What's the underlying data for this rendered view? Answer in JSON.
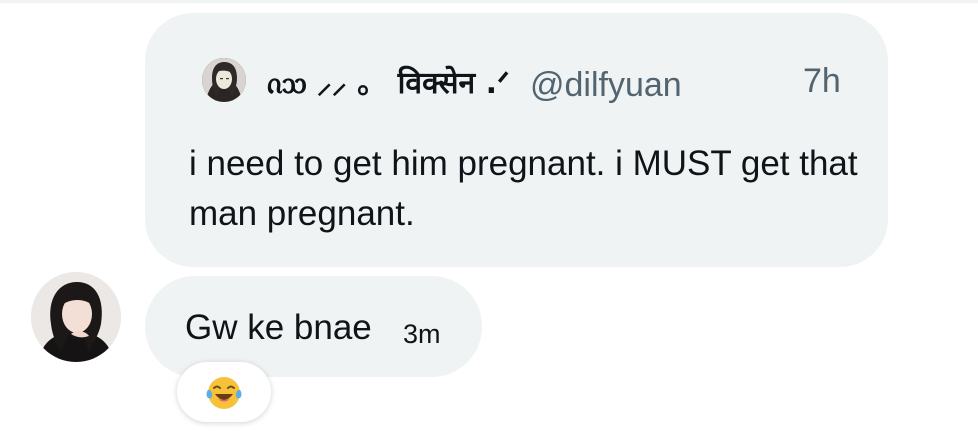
{
  "quoted_post": {
    "author_name": "ᦵᦉ ⸝⸝ 。 विक्सेन .ᐟ",
    "handle": "@dilfyuan",
    "time": "7h",
    "text": "i need to get him pregnant. i MUST get that man pregnant."
  },
  "reply": {
    "text": "Gw ke bnae",
    "time": "3m"
  },
  "reaction": {
    "icon": "face-with-tears-of-joy-icon"
  },
  "colors": {
    "bubble": "#eff3f4",
    "text": "#0f1419",
    "secondary_text": "#536471"
  }
}
